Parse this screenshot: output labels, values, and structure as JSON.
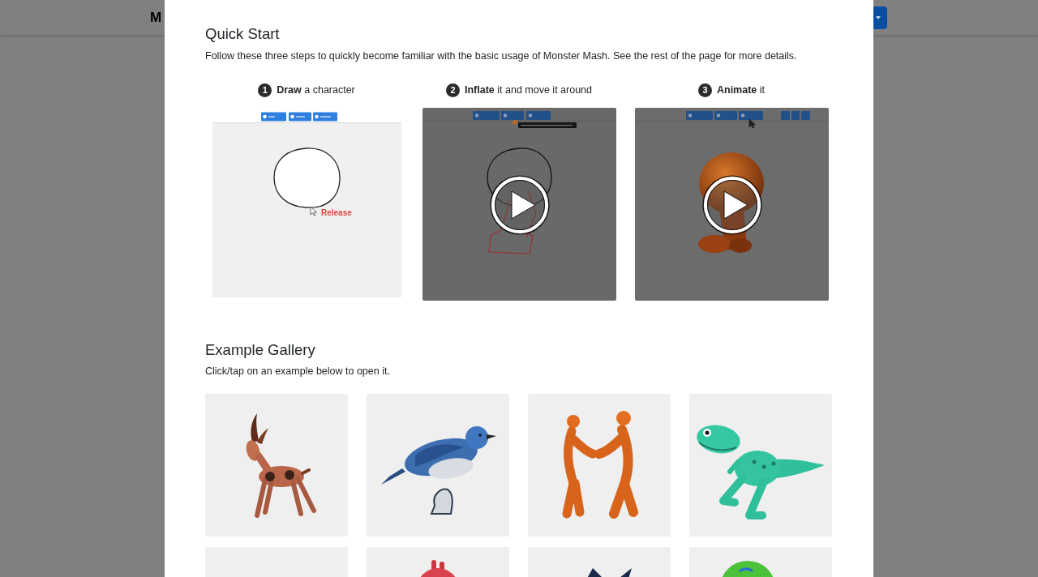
{
  "header": {
    "title": "M"
  },
  "quick_start": {
    "title": "Quick Start",
    "description": "Follow these three steps to quickly become familiar with the basic usage of Monster Mash. See the rest of the page for more details.",
    "steps": [
      {
        "number": "1",
        "label": "**Draw** a character",
        "media": {
          "kind": "sketch",
          "caption": "Release"
        }
      },
      {
        "number": "2",
        "label": "**Inflate** it and move it around",
        "media": {
          "kind": "inflate"
        }
      },
      {
        "number": "3",
        "label": "**Animate** it",
        "media": {
          "kind": "animate"
        }
      }
    ]
  },
  "gallery": {
    "title": "Example Gallery",
    "description": "Click/tap on an example below to open it.",
    "items": [
      {
        "kind": "deer"
      },
      {
        "kind": "bird"
      },
      {
        "kind": "figures"
      },
      {
        "kind": "dinosaur"
      },
      {
        "kind": "blank"
      },
      {
        "kind": "heart"
      },
      {
        "kind": "ears"
      },
      {
        "kind": "blob"
      }
    ]
  }
}
